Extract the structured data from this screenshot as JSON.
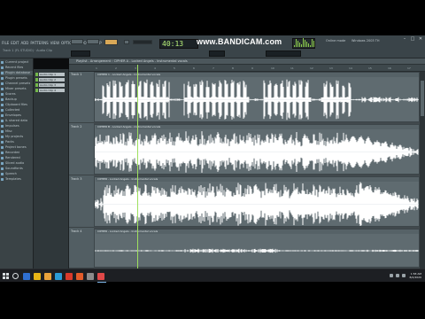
{
  "app": {
    "menu": [
      "FILE",
      "EDIT",
      "ADD",
      "PATTERNS",
      "VIEW",
      "OPTIONS",
      "TOOLS",
      "HELP"
    ],
    "pattern_name": "Track 1 (FL STUDIO) · Audio Clip",
    "tempo_display": "40:13",
    "hint_left": "Online mode",
    "hint_right": "Windows 2003 TH",
    "window_buttons": [
      "–",
      "□",
      "✕"
    ]
  },
  "watermark": "www.BANDICAM.com",
  "browser": {
    "items": [
      "Current project",
      "Recent files",
      "Plugin database",
      "Plugin presets",
      "Channel presets",
      "Mixer presets",
      "Scores",
      "Backup",
      "Clipboard files",
      "Collected",
      "Envelopes",
      "IL shared data",
      "Impulses",
      "Misc",
      "My projects",
      "Packs",
      "Project bones",
      "Recorded",
      "Rendered",
      "Sliced audio",
      "Soundfonts",
      "Speech",
      "Templates"
    ]
  },
  "channels": [
    "Audio Clip 1",
    "Audio Clip 2",
    "Audio Clip 3",
    "Audio Clip 4"
  ],
  "playlist": {
    "title": "Playlist - Arrangement › CIPHER A - Locked Angels - Instrumental vocals",
    "ruler": [
      "1",
      "2",
      "3",
      "4",
      "5",
      "6",
      "7",
      "8",
      "9",
      "10",
      "11",
      "12",
      "13",
      "14",
      "15",
      "16",
      "17"
    ],
    "tracks": [
      {
        "name": "Track 1",
        "clip": "CIPHER 1 - Locked Angels - Instrumental vocals"
      },
      {
        "name": "Track 2",
        "clip": "CIPHER B - Locked Angels - Instrumental vocals"
      },
      {
        "name": "Track 3",
        "clip": "CIPHER - Locked Angels - Instrumental vocals"
      },
      {
        "name": "Track 4",
        "clip": "CIPHER - Locked Angels - Instrumental vocals"
      }
    ]
  },
  "taskbar": {
    "time": "1:58 AM",
    "date": "8/2/2020",
    "app_colors": [
      "#2f6fd1",
      "#e7b416",
      "#e9a23b",
      "#2b9bd6",
      "#d93a2b",
      "#e25b2a",
      "#8b8b8b",
      "#e04848"
    ]
  },
  "colors": {
    "waveform": "#ffffff",
    "clip_bg": "#5f6b70",
    "playhead": "#9fe05f"
  }
}
